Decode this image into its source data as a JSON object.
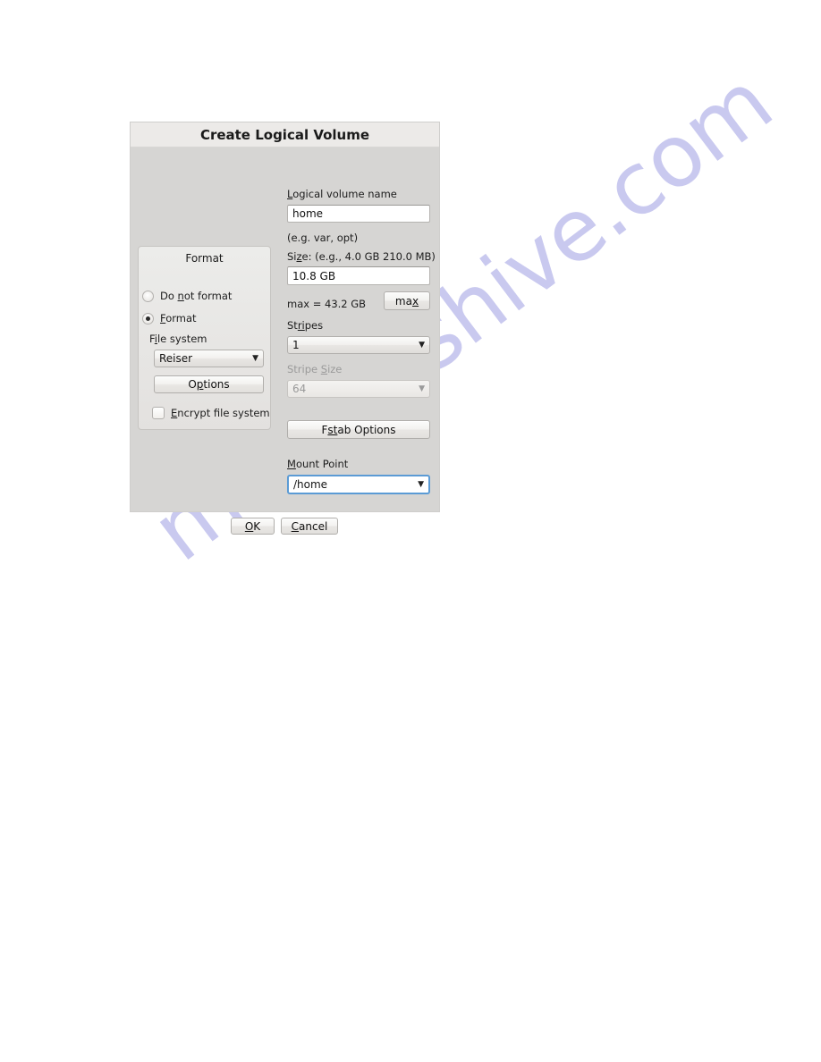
{
  "page": {
    "watermark_text": "manualshive.com",
    "watermark_color": "#c9c9ef",
    "background_color": "#ffffff"
  },
  "dialog": {
    "title": "Create Logical Volume",
    "background_color": "#d6d5d3",
    "titlebar_color": "#eceae8"
  },
  "format_group": {
    "legend": "Format",
    "radio_do_not_format": {
      "label_pre": "Do ",
      "label_accel": "n",
      "label_post": "ot format",
      "selected": false
    },
    "radio_format": {
      "label_pre": "",
      "label_accel": "F",
      "label_post": "ormat",
      "selected": true
    },
    "file_system_label_pre": "F",
    "file_system_label_accel": "i",
    "file_system_label_post": "le system",
    "file_system_value": "Reiser",
    "file_system_options": [
      "Reiser"
    ],
    "options_button_pre": "O",
    "options_button_accel": "p",
    "options_button_post": "tions",
    "encrypt_checkbox_pre": "",
    "encrypt_checkbox_accel": "E",
    "encrypt_checkbox_post": "ncrypt file system",
    "encrypt_checked": false
  },
  "fields": {
    "lv_name_label_pre": "",
    "lv_name_label_accel": "L",
    "lv_name_label_post": "ogical volume name",
    "lv_name_value": "home",
    "lv_name_hint": "(e.g. var, opt)",
    "size_label_pre": "Si",
    "size_label_accel": "z",
    "size_label_post": "e: (e.g.,   4.0 GB  210.0 MB)",
    "size_value": "10.8 GB",
    "max_info_label": "max =  43.2 GB",
    "max_button_pre": "ma",
    "max_button_accel": "x",
    "max_button_post": "",
    "stripes_label_pre": "St",
    "stripes_label_accel": "ri",
    "stripes_label_post": "pes",
    "stripes_value": "1",
    "stripes_options": [
      "1"
    ],
    "stripe_size_label_pre": "Stripe ",
    "stripe_size_label_accel": "S",
    "stripe_size_label_post": "ize",
    "stripe_size_value": "64",
    "stripe_size_options": [
      "64"
    ],
    "stripe_size_disabled": true,
    "fstab_button_pre": "F",
    "fstab_button_accel": "st",
    "fstab_button_post": "ab Options",
    "mount_point_label_pre": "",
    "mount_point_label_accel": "M",
    "mount_point_label_post": "ount Point",
    "mount_point_value": "/home",
    "mount_point_options": [
      "/home"
    ],
    "mount_point_focused": true,
    "focus_border_color": "#5b9bd5"
  },
  "actions": {
    "ok_pre": "",
    "ok_accel": "O",
    "ok_post": "K",
    "cancel_pre": "",
    "cancel_accel": "C",
    "cancel_post": "ancel"
  },
  "icons": {
    "chevron_down": "⌄"
  }
}
